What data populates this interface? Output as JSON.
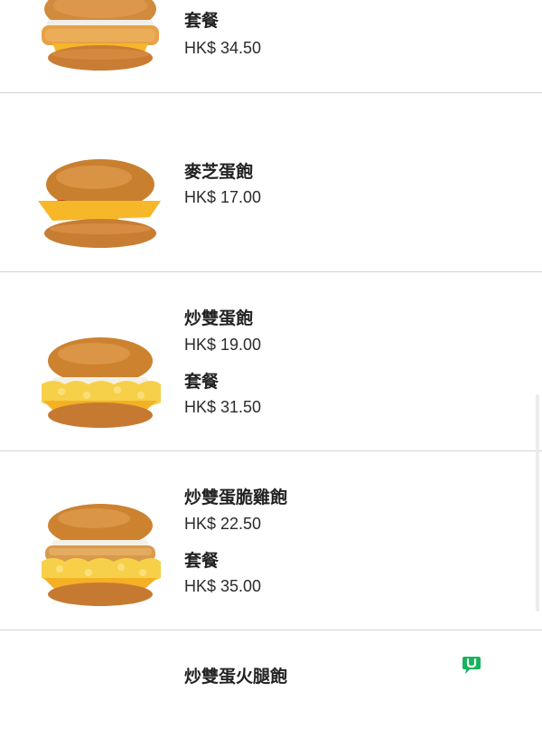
{
  "menu": {
    "items": [
      {
        "name": "",
        "single_price": "",
        "set_label": "套餐",
        "set_price": "HK$ 34.50",
        "image_icon": "fish-fillet-burger-image"
      },
      {
        "name": "麥芝蛋飽",
        "single_price": "HK$ 17.00",
        "set_label": "",
        "set_price": "",
        "image_icon": "egg-cheese-burger-image"
      },
      {
        "name": "炒雙蛋飽",
        "single_price": "HK$ 19.00",
        "set_label": "套餐",
        "set_price": "HK$ 31.50",
        "image_icon": "scrambled-egg-burger-image"
      },
      {
        "name": "炒雙蛋脆雞飽",
        "single_price": "HK$ 22.50",
        "set_label": "套餐",
        "set_price": "HK$ 35.00",
        "image_icon": "scrambled-egg-crispy-chicken-burger-image"
      },
      {
        "name": "炒雙蛋火腿飽",
        "single_price": "",
        "set_label": "",
        "set_price": "",
        "image_icon": ""
      }
    ]
  },
  "watermark": {
    "letter": "U",
    "icon": "u-logo-icon",
    "color": "#16b35f"
  },
  "colors": {
    "bun": "#d48a3c",
    "cheese": "#f5b323",
    "egg": "#f7d44a",
    "separator": "#d2d2d2"
  }
}
